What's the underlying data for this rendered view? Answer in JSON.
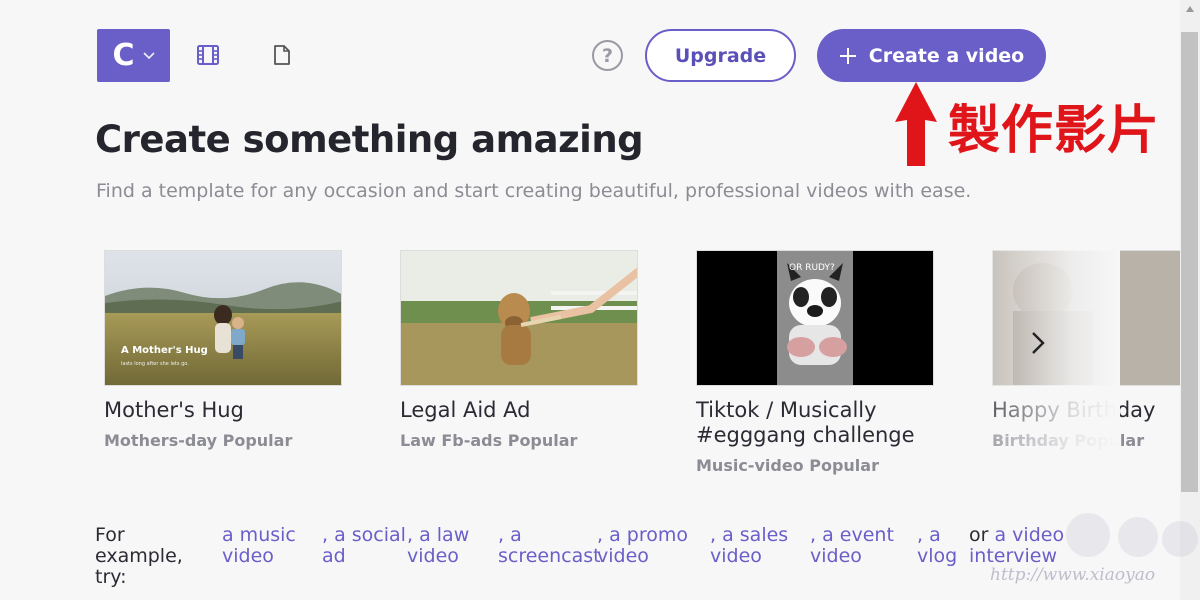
{
  "header": {
    "logo_letter": "C",
    "upgrade_label": "Upgrade",
    "create_label": "Create a video",
    "help_label": "?"
  },
  "annotation": {
    "text": "製作影片",
    "color": "#e0151a"
  },
  "main": {
    "title": "Create something amazing",
    "subtitle": "Find a template for any occasion and start creating beautiful, professional videos with ease."
  },
  "templates": [
    {
      "title": "Mother's Hug",
      "tags": "Mothers-day Popular",
      "overlay_title": "A Mother's Hug",
      "overlay_sub": "lasts long after she lets go."
    },
    {
      "title": "Legal Aid Ad",
      "tags": "Law Fb-ads Popular"
    },
    {
      "title": "Tiktok / Musically #egggang challenge",
      "tags": "Music-video Popular",
      "overlay_title": "OR RUDY?"
    },
    {
      "title": "Happy Birthday",
      "tags": "Birthday Popular"
    }
  ],
  "examples": {
    "label": "For example, try:",
    "links": [
      {
        "pre": "",
        "text": "a music video"
      },
      {
        "pre": ", ",
        "text": "a social ad"
      },
      {
        "pre": ", ",
        "text": "a law video"
      },
      {
        "pre": ", ",
        "text": "a screencast"
      },
      {
        "pre": ", ",
        "text": "a promo video"
      },
      {
        "pre": ", ",
        "text": "a sales video"
      },
      {
        "pre": ", ",
        "text": "a event video"
      },
      {
        "pre": ", ",
        "text": "a vlog"
      },
      {
        "pre": "or ",
        "text": "a video interview"
      }
    ]
  },
  "watermark": {
    "text": "http://www.xiaoyao"
  },
  "colors": {
    "accent": "#6a5ec8",
    "text": "#2b2b33",
    "muted": "#8c8c94"
  }
}
